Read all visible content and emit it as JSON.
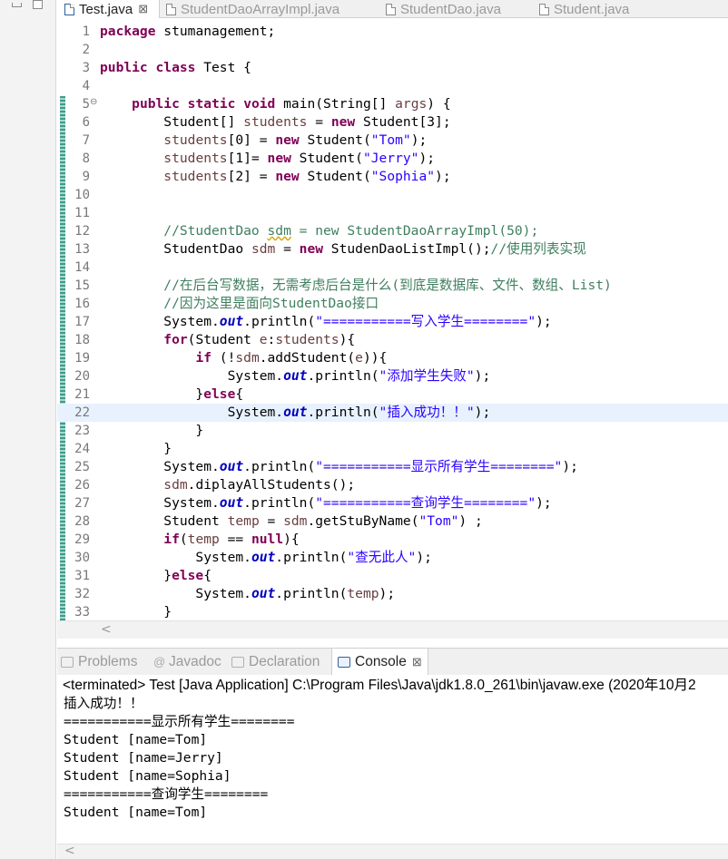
{
  "editor_tabs": [
    {
      "label": "Test.java",
      "active": true
    },
    {
      "label": "StudentDaoArrayImpl.java",
      "active": false
    },
    {
      "label": "StudentDao.java",
      "active": false
    },
    {
      "label": "Student.java",
      "active": false
    }
  ],
  "close_glyph": "⊠",
  "code": {
    "line_numbers": [
      "1",
      "2",
      "3",
      "4",
      "5",
      "6",
      "7",
      "8",
      "9",
      "10",
      "11",
      "12",
      "13",
      "14",
      "15",
      "16",
      "17",
      "18",
      "19",
      "20",
      "21",
      "22",
      "23",
      "24",
      "25",
      "26",
      "27",
      "28",
      "29",
      "30",
      "31",
      "32",
      "33"
    ],
    "current_line": 22,
    "fold_marker_line": 5,
    "lines": [
      [
        {
          "t": "kw",
          "v": "package"
        },
        {
          "t": "pl",
          "v": " stumanagement;"
        }
      ],
      [],
      [
        {
          "t": "kw",
          "v": "public"
        },
        {
          "t": "pl",
          "v": " "
        },
        {
          "t": "kw",
          "v": "class"
        },
        {
          "t": "pl",
          "v": " Test {"
        }
      ],
      [],
      [
        {
          "t": "pl",
          "v": "    "
        },
        {
          "t": "kw",
          "v": "public"
        },
        {
          "t": "pl",
          "v": " "
        },
        {
          "t": "kw",
          "v": "static"
        },
        {
          "t": "pl",
          "v": " "
        },
        {
          "t": "kw",
          "v": "void"
        },
        {
          "t": "pl",
          "v": " main(String[] "
        },
        {
          "t": "var",
          "v": "args"
        },
        {
          "t": "pl",
          "v": ") {"
        }
      ],
      [
        {
          "t": "pl",
          "v": "        Student[] "
        },
        {
          "t": "var",
          "v": "students"
        },
        {
          "t": "pl",
          "v": " = "
        },
        {
          "t": "kw",
          "v": "new"
        },
        {
          "t": "pl",
          "v": " Student[3];"
        }
      ],
      [
        {
          "t": "pl",
          "v": "        "
        },
        {
          "t": "var",
          "v": "students"
        },
        {
          "t": "pl",
          "v": "[0] = "
        },
        {
          "t": "kw",
          "v": "new"
        },
        {
          "t": "pl",
          "v": " Student("
        },
        {
          "t": "str",
          "v": "\"Tom\""
        },
        {
          "t": "pl",
          "v": ");"
        }
      ],
      [
        {
          "t": "pl",
          "v": "        "
        },
        {
          "t": "var",
          "v": "students"
        },
        {
          "t": "pl",
          "v": "[1]= "
        },
        {
          "t": "kw",
          "v": "new"
        },
        {
          "t": "pl",
          "v": " Student("
        },
        {
          "t": "str",
          "v": "\"Jerry\""
        },
        {
          "t": "pl",
          "v": ");"
        }
      ],
      [
        {
          "t": "pl",
          "v": "        "
        },
        {
          "t": "var",
          "v": "students"
        },
        {
          "t": "pl",
          "v": "[2] = "
        },
        {
          "t": "kw",
          "v": "new"
        },
        {
          "t": "pl",
          "v": " Student("
        },
        {
          "t": "str",
          "v": "\"Sophia\""
        },
        {
          "t": "pl",
          "v": ");"
        }
      ],
      [],
      [],
      [
        {
          "t": "cmt",
          "v": "        //StudentDao "
        },
        {
          "t": "cmtw",
          "v": "sdm"
        },
        {
          "t": "cmt",
          "v": " = new StudentDaoArrayImpl(50);"
        }
      ],
      [
        {
          "t": "pl",
          "v": "        StudentDao "
        },
        {
          "t": "var",
          "v": "sdm"
        },
        {
          "t": "pl",
          "v": " = "
        },
        {
          "t": "kw",
          "v": "new"
        },
        {
          "t": "pl",
          "v": " StudenDaoListImpl();"
        },
        {
          "t": "cmt",
          "v": "//使用列表实现"
        }
      ],
      [],
      [
        {
          "t": "cmt",
          "v": "        //在后台写数据，无需考虑后台是什么(到底是数据库、文件、数组、List)"
        }
      ],
      [
        {
          "t": "cmt",
          "v": "        //因为这里是面向StudentDao接口"
        }
      ],
      [
        {
          "t": "pl",
          "v": "        System."
        },
        {
          "t": "fld",
          "v": "out"
        },
        {
          "t": "pl",
          "v": ".println("
        },
        {
          "t": "str",
          "v": "\"===========写入学生========\""
        },
        {
          "t": "pl",
          "v": ");"
        }
      ],
      [
        {
          "t": "pl",
          "v": "        "
        },
        {
          "t": "kw",
          "v": "for"
        },
        {
          "t": "pl",
          "v": "(Student "
        },
        {
          "t": "var",
          "v": "e"
        },
        {
          "t": "pl",
          "v": ":"
        },
        {
          "t": "var",
          "v": "students"
        },
        {
          "t": "pl",
          "v": "){"
        }
      ],
      [
        {
          "t": "pl",
          "v": "            "
        },
        {
          "t": "kw",
          "v": "if"
        },
        {
          "t": "pl",
          "v": " (!"
        },
        {
          "t": "var",
          "v": "sdm"
        },
        {
          "t": "pl",
          "v": ".addStudent("
        },
        {
          "t": "var",
          "v": "e"
        },
        {
          "t": "pl",
          "v": ")){"
        }
      ],
      [
        {
          "t": "pl",
          "v": "                System."
        },
        {
          "t": "fld",
          "v": "out"
        },
        {
          "t": "pl",
          "v": ".println("
        },
        {
          "t": "str",
          "v": "\"添加学生失败\""
        },
        {
          "t": "pl",
          "v": ");"
        }
      ],
      [
        {
          "t": "pl",
          "v": "            }"
        },
        {
          "t": "kw",
          "v": "else"
        },
        {
          "t": "pl",
          "v": "{"
        }
      ],
      [
        {
          "t": "pl",
          "v": "                System."
        },
        {
          "t": "fld",
          "v": "out"
        },
        {
          "t": "pl",
          "v": ".println("
        },
        {
          "t": "str",
          "v": "\"插入成功！！\""
        },
        {
          "t": "pl",
          "v": ");"
        }
      ],
      [
        {
          "t": "pl",
          "v": "            }"
        }
      ],
      [
        {
          "t": "pl",
          "v": "        }"
        }
      ],
      [
        {
          "t": "pl",
          "v": "        System."
        },
        {
          "t": "fld",
          "v": "out"
        },
        {
          "t": "pl",
          "v": ".println("
        },
        {
          "t": "str",
          "v": "\"===========显示所有学生========\""
        },
        {
          "t": "pl",
          "v": ");"
        }
      ],
      [
        {
          "t": "pl",
          "v": "        "
        },
        {
          "t": "var",
          "v": "sdm"
        },
        {
          "t": "pl",
          "v": ".diplayAllStudents();"
        }
      ],
      [
        {
          "t": "pl",
          "v": "        System."
        },
        {
          "t": "fld",
          "v": "out"
        },
        {
          "t": "pl",
          "v": ".println("
        },
        {
          "t": "str",
          "v": "\"===========查询学生========\""
        },
        {
          "t": "pl",
          "v": ");"
        }
      ],
      [
        {
          "t": "pl",
          "v": "        Student "
        },
        {
          "t": "var",
          "v": "temp"
        },
        {
          "t": "pl",
          "v": " = "
        },
        {
          "t": "var",
          "v": "sdm"
        },
        {
          "t": "pl",
          "v": ".getStuByName("
        },
        {
          "t": "str",
          "v": "\"Tom\""
        },
        {
          "t": "pl",
          "v": ") ;"
        }
      ],
      [
        {
          "t": "pl",
          "v": "        "
        },
        {
          "t": "kw",
          "v": "if"
        },
        {
          "t": "pl",
          "v": "("
        },
        {
          "t": "var",
          "v": "temp"
        },
        {
          "t": "pl",
          "v": " == "
        },
        {
          "t": "kw",
          "v": "null"
        },
        {
          "t": "pl",
          "v": "){"
        }
      ],
      [
        {
          "t": "pl",
          "v": "            System."
        },
        {
          "t": "fld",
          "v": "out"
        },
        {
          "t": "pl",
          "v": ".println("
        },
        {
          "t": "str",
          "v": "\"查无此人\""
        },
        {
          "t": "pl",
          "v": ");"
        }
      ],
      [
        {
          "t": "pl",
          "v": "        }"
        },
        {
          "t": "kw",
          "v": "else"
        },
        {
          "t": "pl",
          "v": "{"
        }
      ],
      [
        {
          "t": "pl",
          "v": "            System."
        },
        {
          "t": "fld",
          "v": "out"
        },
        {
          "t": "pl",
          "v": ".println("
        },
        {
          "t": "var",
          "v": "temp"
        },
        {
          "t": "pl",
          "v": ");"
        }
      ],
      [
        {
          "t": "pl",
          "v": "        }"
        }
      ]
    ]
  },
  "scroll_left_glyph": "<",
  "panel_tabs": [
    {
      "label": "Problems",
      "icon": "problems-icon",
      "active": false
    },
    {
      "label": "Javadoc",
      "icon": "javadoc-icon",
      "active": false
    },
    {
      "label": "Declaration",
      "icon": "declaration-icon",
      "active": false
    },
    {
      "label": "Console",
      "icon": "console-icon",
      "active": true
    }
  ],
  "javadoc_glyph": "@",
  "console": {
    "terminated": "<terminated> Test [Java Application] C:\\Program Files\\Java\\jdk1.8.0_261\\bin\\javaw.exe (2020年10月2",
    "lines": [
      "插入成功！！",
      "===========显示所有学生========",
      "Student [name=Tom]",
      "Student [name=Jerry]",
      "Student [name=Sophia]",
      "===========查询学生========",
      "Student [name=Tom]"
    ]
  }
}
